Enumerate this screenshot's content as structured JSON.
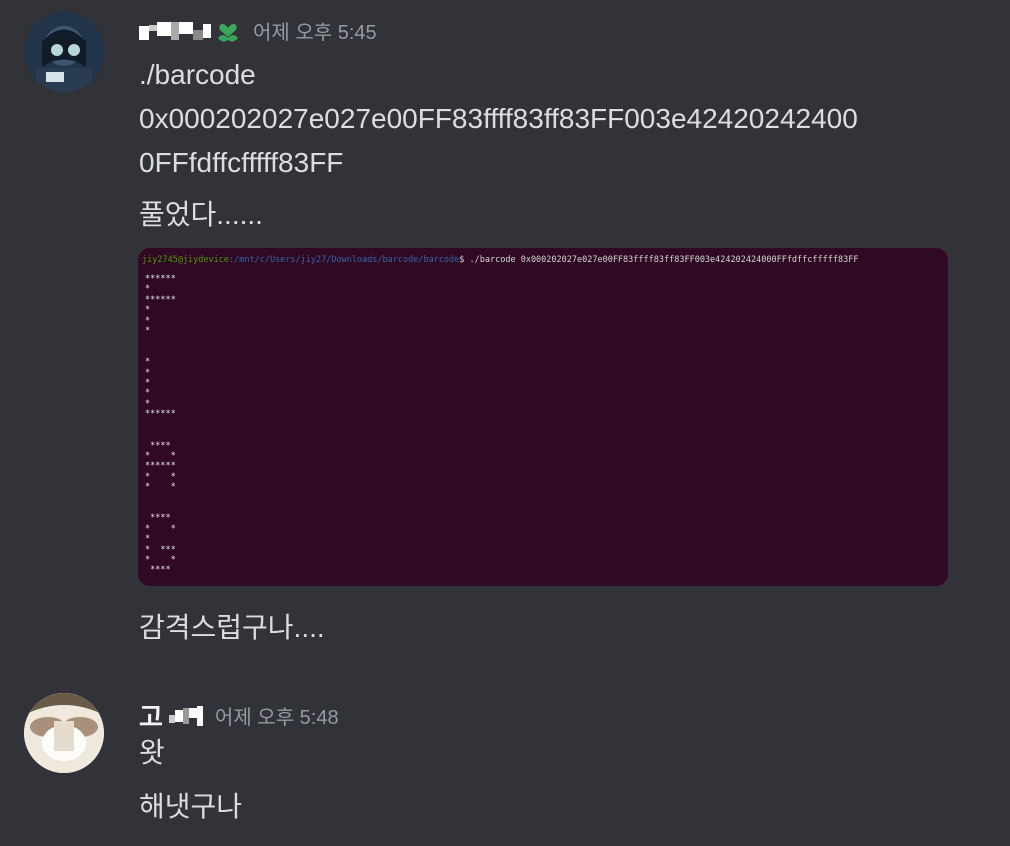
{
  "messages": [
    {
      "author": "",
      "timestamp": "어제 오후 5:45",
      "lines": [
        "./barcode",
        "0x000202027e027e00FF83ffff83ff83FF003e42420242400",
        "0FFfdffcfffff83FF",
        "풀었다......"
      ],
      "attachment": {
        "prompt_user": "jiy2745@jiydevice",
        "prompt_path": ":/mnt/c/Users/jiy27/Downloads/barcode/barcode",
        "prompt_cmd": "$ ./barcode 0x000202027e027e00FF83ffff83ff83FF003e424202424000FFfdffcfffff83FF",
        "output": "******\n*\n******\n*\n*\n*\n\n\n*\n*\n*\n*\n*\n******\n\n\n ****\n*    *\n******\n*    *\n*    *\n\n\n ****\n*    *\n*\n*  ***\n*    *\n ****"
      },
      "after_text": "감격스럽구나...."
    },
    {
      "author": "고",
      "timestamp": "어제 오후 5:48",
      "lines": [
        "왓",
        "해냇구나"
      ]
    }
  ],
  "colors": {
    "background": "#313338",
    "terminal_bg": "#300a24",
    "timestamp": "#949ba4",
    "text": "#dbdee1",
    "badge": "#3ba55c"
  }
}
